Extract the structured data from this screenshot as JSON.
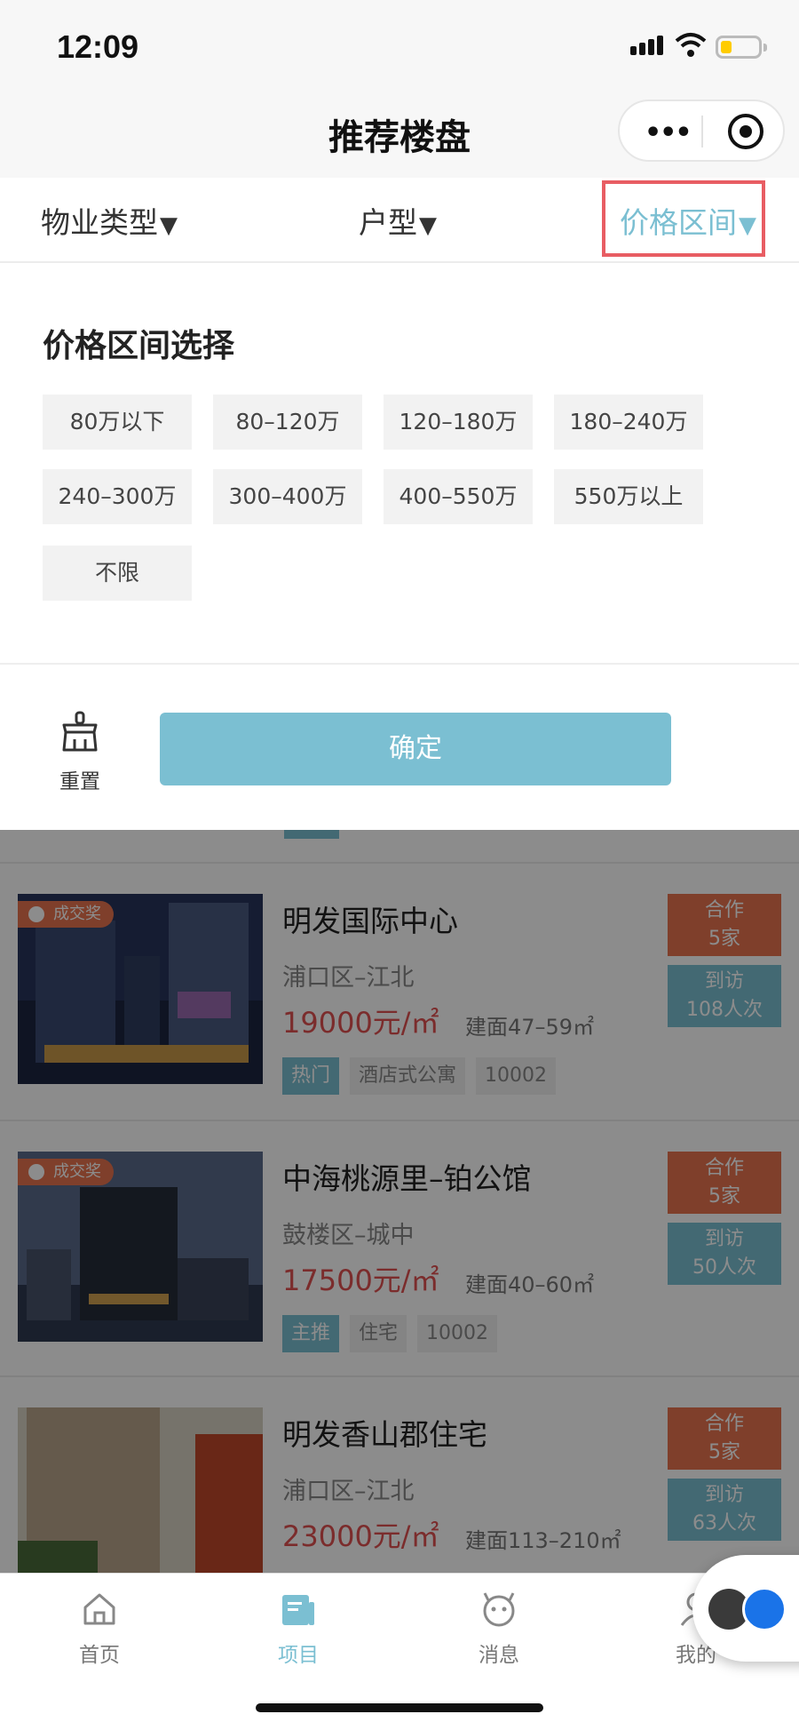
{
  "status_bar": {
    "time": "12:09"
  },
  "nav": {
    "title": "推荐楼盘",
    "more_icon": "more-dots-icon",
    "close_icon": "target-icon"
  },
  "filters": {
    "tabs": [
      {
        "label": "物业类型",
        "arrow": "▼",
        "active": false
      },
      {
        "label": "户型",
        "arrow": "▼",
        "active": false
      },
      {
        "label": "价格区间",
        "arrow": "▼",
        "active": true
      }
    ]
  },
  "price_panel": {
    "title": "价格区间选择",
    "options": [
      "80万以下",
      "80–120万",
      "120–180万",
      "180–240万",
      "240–300万",
      "300–400万",
      "400–550万",
      "550万以上",
      "不限"
    ]
  },
  "actions": {
    "reset_label": "重置",
    "confirm_label": "确定"
  },
  "listings": [
    {
      "award": "成交奖",
      "name": "明发国际中心",
      "area": "浦口区–江北",
      "price": "19000元/㎡",
      "size": "建面47–59㎡",
      "tags": [
        "热门",
        "酒店式公寓",
        "10002"
      ],
      "coop": [
        "合作",
        "5家"
      ],
      "visit": [
        "到访",
        "108人次"
      ]
    },
    {
      "award": "成交奖",
      "name": "中海桃源里–铂公馆",
      "area": "鼓楼区–城中",
      "price": "17500元/㎡",
      "size": "建面40–60㎡",
      "tags": [
        "主推",
        "住宅",
        "10002"
      ],
      "coop": [
        "合作",
        "5家"
      ],
      "visit": [
        "到访",
        "50人次"
      ]
    },
    {
      "award": "",
      "name": "明发香山郡住宅",
      "area": "浦口区–江北",
      "price": "23000元/㎡",
      "size": "建面113–210㎡",
      "tags": [],
      "coop": [
        "合作",
        "5家"
      ],
      "visit": [
        "到访",
        "63人次"
      ]
    }
  ],
  "tabbar": {
    "items": [
      {
        "label": "首页",
        "icon": "home-icon",
        "active": false
      },
      {
        "label": "项目",
        "icon": "project-icon",
        "active": true
      },
      {
        "label": "消息",
        "icon": "message-icon",
        "active": false
      },
      {
        "label": "我的",
        "icon": "profile-icon",
        "active": false
      }
    ]
  },
  "colors": {
    "accent": "#7bbfd2",
    "price": "#e05050",
    "award": "#e8744f",
    "highlight": "#e85d63"
  }
}
